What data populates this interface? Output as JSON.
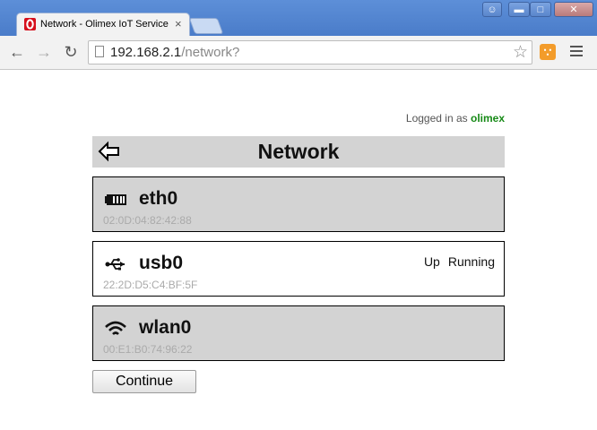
{
  "browser": {
    "tab_title": "Network - Olimex IoT Service",
    "url_host": "192.168.2.1",
    "url_path": "/network?",
    "accent_color": "#4a7cc9"
  },
  "session": {
    "logged_in_prefix": "Logged in as",
    "username": "olimex",
    "username_color": "#178a17"
  },
  "page": {
    "title": "Network",
    "back_icon": "arrow-left-icon"
  },
  "interfaces": [
    {
      "name": "eth0",
      "mac": "02:0D:04:82:42:88",
      "icon": "ethernet-icon",
      "status": [],
      "background": "#d3d3d3"
    },
    {
      "name": "usb0",
      "mac": "22:2D:D5:C4:BF:5F",
      "icon": "usb-icon",
      "status": [
        "Up",
        "Running"
      ],
      "background": "#ffffff"
    },
    {
      "name": "wlan0",
      "mac": "00:E1:B0:74:96:22",
      "icon": "wifi-icon",
      "status": [],
      "background": "#d3d3d3"
    }
  ],
  "actions": {
    "continue_label": "Continue"
  }
}
